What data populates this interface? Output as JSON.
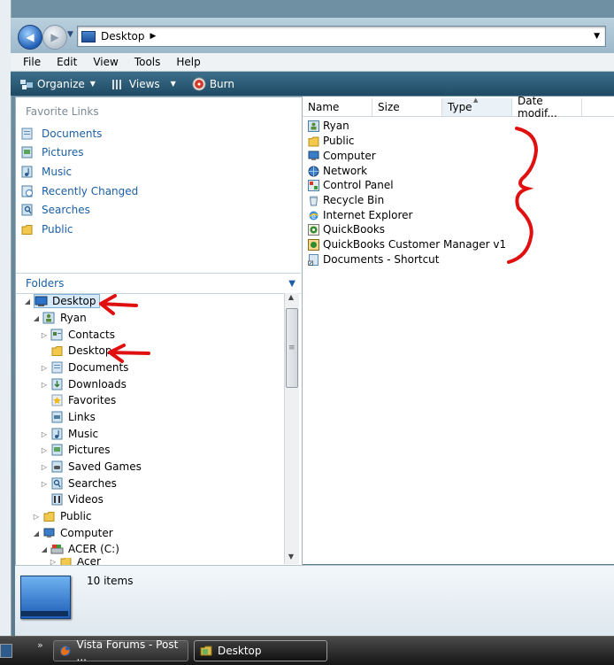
{
  "window": {
    "address": {
      "location": "Desktop"
    }
  },
  "menu": [
    "File",
    "Edit",
    "View",
    "Tools",
    "Help"
  ],
  "toolbar": {
    "organize": "Organize",
    "views": "Views",
    "burn": "Burn"
  },
  "favorites": {
    "title": "Favorite Links",
    "items": [
      {
        "label": "Documents",
        "icon": "documents-icon"
      },
      {
        "label": "Pictures",
        "icon": "pictures-icon"
      },
      {
        "label": "Music",
        "icon": "music-icon"
      },
      {
        "label": "Recently Changed",
        "icon": "recent-icon"
      },
      {
        "label": "Searches",
        "icon": "searches-icon"
      },
      {
        "label": "Public",
        "icon": "public-folder-icon"
      }
    ]
  },
  "folders": {
    "title": "Folders",
    "tree": [
      {
        "label": "Desktop",
        "icon": "desktop-icon",
        "expander": "expanded",
        "selected": true
      },
      {
        "label": "Ryan",
        "icon": "user-icon",
        "expander": "expanded"
      },
      {
        "label": "Contacts",
        "icon": "contacts-icon",
        "expander": "collapsed"
      },
      {
        "label": "Desktop",
        "icon": "folder-icon",
        "expander": "none"
      },
      {
        "label": "Documents",
        "icon": "documents-icon",
        "expander": "collapsed"
      },
      {
        "label": "Downloads",
        "icon": "downloads-icon",
        "expander": "collapsed"
      },
      {
        "label": "Favorites",
        "icon": "favorites-icon",
        "expander": "none"
      },
      {
        "label": "Links",
        "icon": "links-icon",
        "expander": "none"
      },
      {
        "label": "Music",
        "icon": "music-icon",
        "expander": "collapsed"
      },
      {
        "label": "Pictures",
        "icon": "pictures-icon",
        "expander": "collapsed"
      },
      {
        "label": "Saved Games",
        "icon": "saved-games-icon",
        "expander": "collapsed"
      },
      {
        "label": "Searches",
        "icon": "searches-icon",
        "expander": "collapsed"
      },
      {
        "label": "Videos",
        "icon": "videos-icon",
        "expander": "none"
      },
      {
        "label": "Public",
        "icon": "public-folder-icon",
        "expander": "collapsed"
      },
      {
        "label": "Computer",
        "icon": "computer-icon",
        "expander": "expanded"
      },
      {
        "label": "ACER (C:)",
        "icon": "drive-icon",
        "expander": "expanded"
      },
      {
        "label": "Acer",
        "icon": "folder-icon",
        "expander": "collapsed"
      }
    ]
  },
  "columns": [
    "Name",
    "Size",
    "Type",
    "Date modif..."
  ],
  "files": [
    {
      "name": "Ryan",
      "icon": "user-folder-icon"
    },
    {
      "name": "Public",
      "icon": "public-folder-icon"
    },
    {
      "name": "Computer",
      "icon": "computer-icon"
    },
    {
      "name": "Network",
      "icon": "network-icon"
    },
    {
      "name": "Control Panel",
      "icon": "control-panel-icon"
    },
    {
      "name": "Recycle Bin",
      "icon": "recycle-bin-icon"
    },
    {
      "name": "Internet Explorer",
      "icon": "internet-explorer-icon"
    },
    {
      "name": "QuickBooks",
      "icon": "quickbooks-icon"
    },
    {
      "name": "QuickBooks Customer Manager v1",
      "icon": "quickbooks-cm-icon"
    },
    {
      "name": "Documents - Shortcut",
      "icon": "shortcut-icon"
    }
  ],
  "details": {
    "count": "10 items"
  },
  "taskbar": {
    "tasks": [
      {
        "label": "Vista Forums - Post ...",
        "icon": "firefox-icon"
      },
      {
        "label": "Desktop",
        "icon": "explorer-folder-icon"
      }
    ],
    "overflow": "»"
  },
  "colors": {
    "link": "#1b5fa6",
    "annotation": "#e01010",
    "toolbar": "#2a5a76"
  }
}
